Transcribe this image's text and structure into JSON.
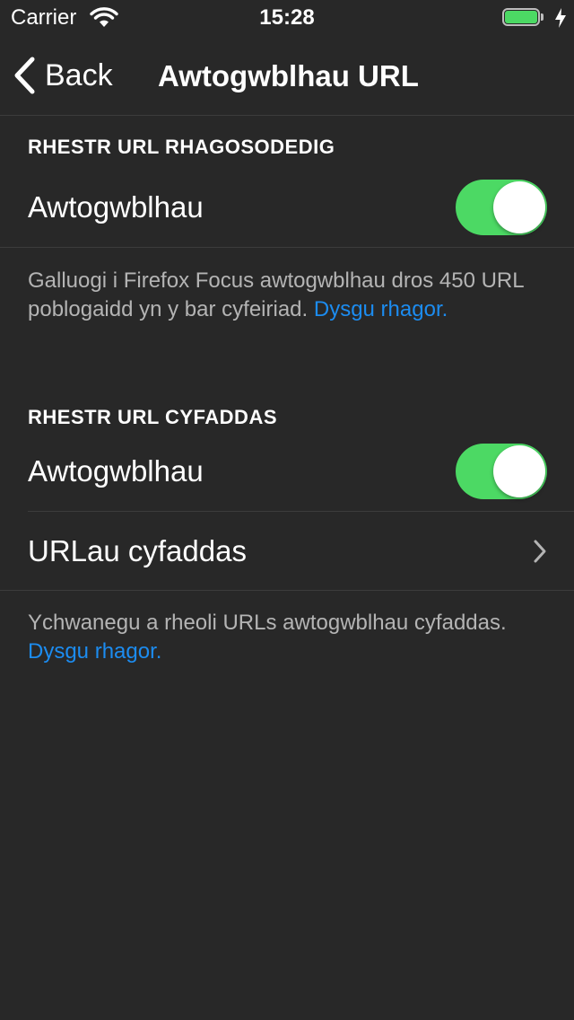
{
  "status_bar": {
    "carrier": "Carrier",
    "time": "15:28",
    "battery_level": 1.0,
    "battery_color": "#4cd964",
    "icons": [
      "wifi-icon",
      "battery-icon",
      "charging-bolt-icon"
    ]
  },
  "nav": {
    "back_label": "Back",
    "title": "Awtogwblhau URL",
    "icons": [
      "chevron-left-icon"
    ]
  },
  "sections": {
    "default_list": {
      "header": "RHESTR URL RHAGOSODEDIG",
      "toggle_label": "Awtogwblhau",
      "toggle_on": true,
      "footer": "Galluogi i Firefox Focus awtogwblhau dros 450 URL poblogaidd yn y bar cyfeiriad.",
      "footer_link": "Dysgu rhagor."
    },
    "custom_list": {
      "header": "RHESTR URL CYFADDAS",
      "toggle_label": "Awtogwblhau",
      "toggle_on": true,
      "custom_urls_label": "URLau cyfaddas",
      "footer": "Ychwanegu a rheoli URLs awtogwblhau cyfaddas.",
      "footer_link": "Dysgu rhagor."
    }
  },
  "colors": {
    "background": "#282828",
    "toggle_on": "#4cd964",
    "link": "#1c8cf0",
    "footer_text": "#b4b4b4",
    "separator": "#3c3c3c"
  }
}
